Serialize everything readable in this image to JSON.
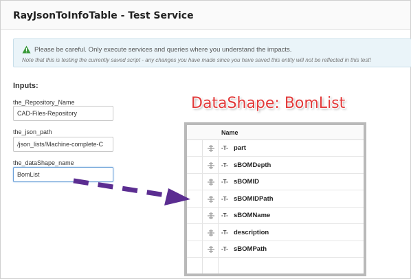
{
  "header": {
    "title": "RayJsonToInfoTable - Test Service"
  },
  "warning": {
    "icon": "warning-icon",
    "message": "Please be careful. Only execute services and queries where you understand the impacts.",
    "note": "Note that this is testing the currently saved script - any changes you have made since you have saved this entity will not be reflected in this test!"
  },
  "inputs": {
    "heading": "Inputs:",
    "fields": [
      {
        "label": "the_Repository_Name",
        "value": "CAD-Files-Repository"
      },
      {
        "label": "the_json_path",
        "value": "/json_lists/Machine-complete-C"
      },
      {
        "label": "the_dataShape_name",
        "value": "BomList"
      }
    ]
  },
  "annotation": {
    "title": "DataShape: BomList",
    "color": "#e23a3a",
    "arrow_color": "#5b2d91"
  },
  "datashape_grid": {
    "column_header": "Name",
    "type_glyph": "-T-",
    "rows": [
      {
        "name": "part"
      },
      {
        "name": "sBOMDepth"
      },
      {
        "name": "sBOMID"
      },
      {
        "name": "sBOMIDPath"
      },
      {
        "name": "sBOMName"
      },
      {
        "name": "description"
      },
      {
        "name": "sBOMPath"
      }
    ]
  }
}
